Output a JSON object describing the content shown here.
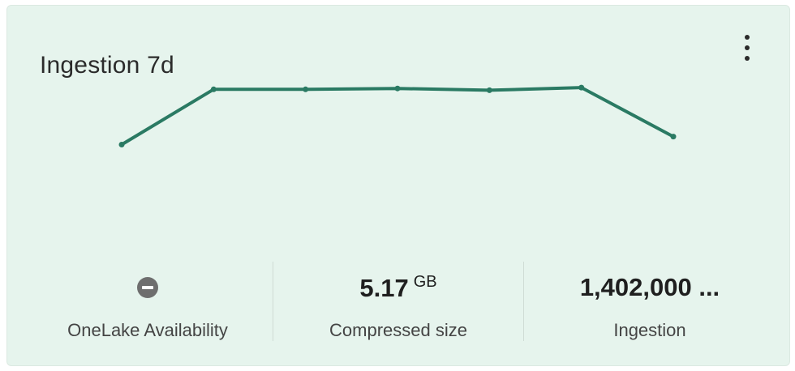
{
  "card": {
    "title": "Ingestion 7d",
    "more_icon": "more-vertical-icon"
  },
  "chart_data": {
    "type": "line",
    "title": "",
    "xlabel": "",
    "ylabel": "",
    "grid": false,
    "x": [
      1,
      2,
      3,
      4,
      5,
      6,
      7
    ],
    "series": [
      {
        "values": [
          0.35,
          0.97,
          0.97,
          0.98,
          0.96,
          0.99,
          0.44
        ],
        "color": "#2a7a63"
      }
    ],
    "ylim": [
      0,
      1
    ]
  },
  "metrics": [
    {
      "label": "OneLake Availability",
      "icon": "status-disabled-icon",
      "value": "",
      "unit": ""
    },
    {
      "label": "Compressed size",
      "value": "5.17",
      "unit": "GB"
    },
    {
      "label": "Ingestion",
      "value": "1,402,000 ...",
      "unit": ""
    }
  ],
  "colors": {
    "card_background": "#e6f4ed",
    "line": "#2a7a63",
    "status_icon": "#6e6e6e"
  }
}
